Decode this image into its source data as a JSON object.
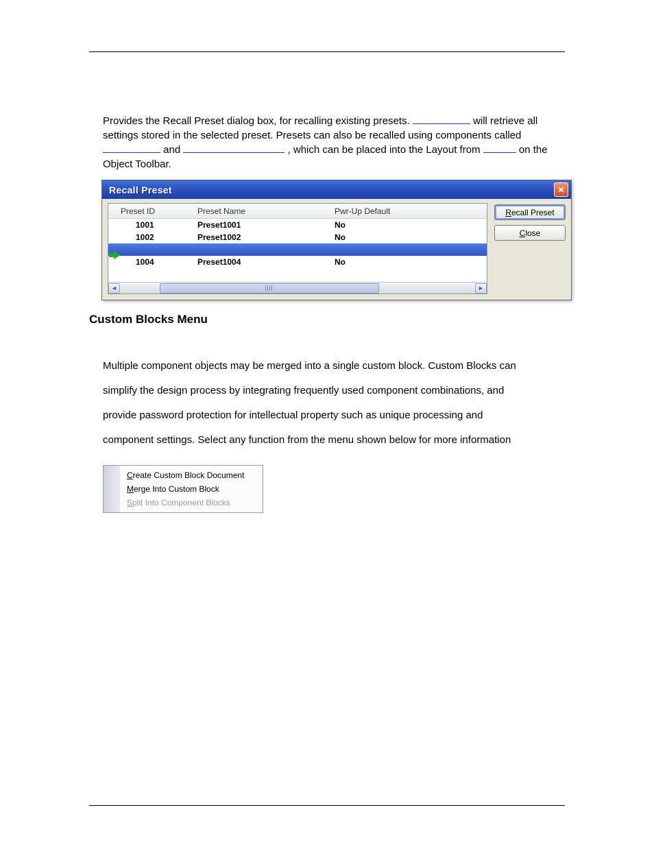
{
  "paragraph": {
    "p1a": "Provides the Recall Preset dialog box, for recalling existing presets. ",
    "p1b": " will retrieve all settings stored in the selected preset. Presets can also be recalled using components called ",
    "p1c": " and ",
    "p1d": ", which can be placed into the Layout from ",
    "p1e": " on the Object Toolbar.",
    "blank1_width": 84,
    "blank2_width": 84,
    "blank3_width": 148,
    "blank4_width": 48
  },
  "dialog": {
    "title": "Recall Preset",
    "columns": {
      "id": "Preset ID",
      "name": "Preset Name",
      "def": "Pwr-Up Default"
    },
    "rows": [
      {
        "id": "1001",
        "name": "Preset1001",
        "def": "No",
        "selected": false,
        "arrow": false
      },
      {
        "id": "1002",
        "name": "Preset1002",
        "def": "No",
        "selected": false,
        "arrow": false
      },
      {
        "id": "",
        "name": "",
        "def": "",
        "selected": true,
        "arrow": true
      },
      {
        "id": "1004",
        "name": "Preset1004",
        "def": "No",
        "selected": false,
        "arrow": false
      }
    ],
    "buttons": {
      "recall_html": "<u>R</u>ecall Preset",
      "close_html": "<u>C</u>lose"
    }
  },
  "section_heading": "Custom Blocks Menu",
  "body_text": "Multiple component objects may be merged into a single custom block. Custom Blocks can simplify the design process by integrating frequently used component combinations, and provide password protection for intellectual property such as unique processing and component settings. Select any function from the menu shown below for more information",
  "menu": {
    "items": [
      {
        "html": "<u>C</u>reate Custom Block Document",
        "disabled": false
      },
      {
        "html": "<u>M</u>erge Into Custom Block",
        "disabled": false
      },
      {
        "html": "<u>S</u>plit Into Component Blocks",
        "disabled": true
      }
    ]
  }
}
